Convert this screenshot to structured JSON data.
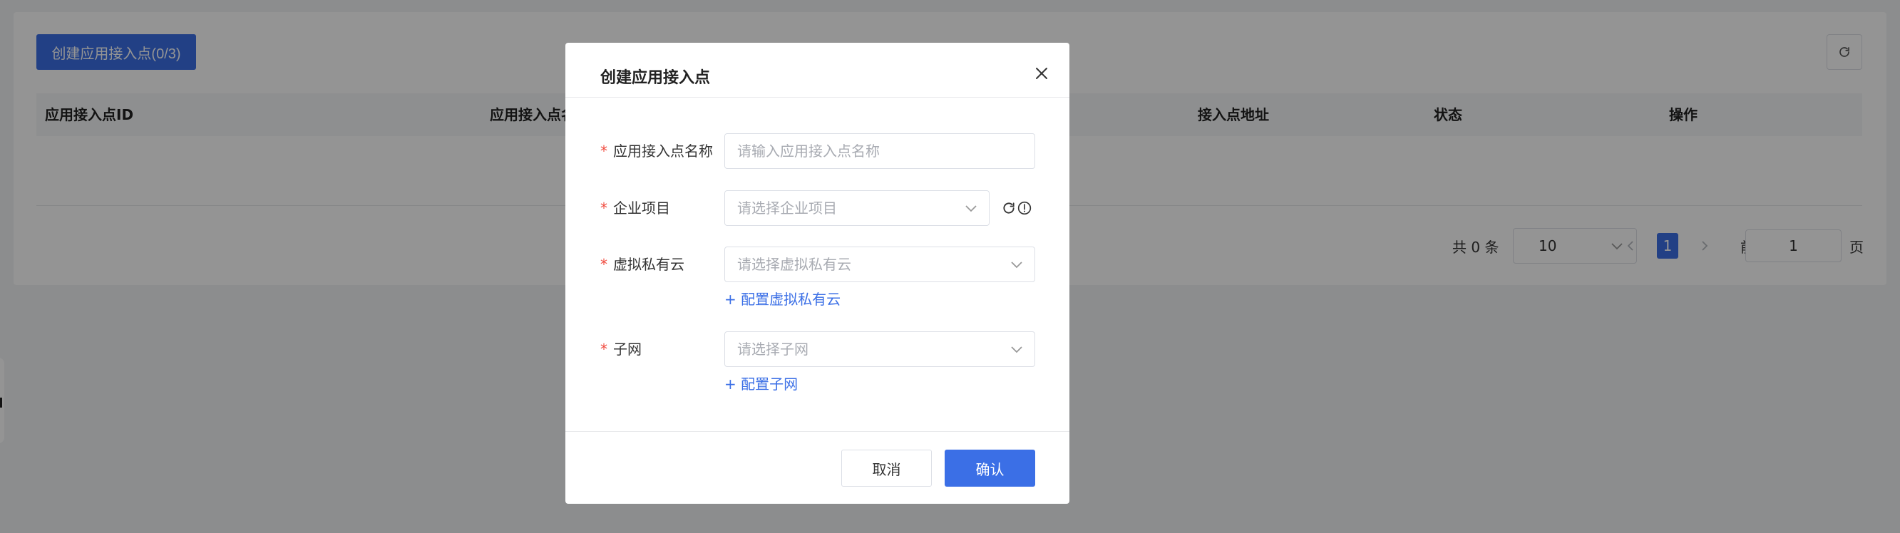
{
  "toolbar": {
    "create_button_label": "创建应用接入点(0/3)"
  },
  "table": {
    "columns": [
      "应用接入点ID",
      "应用接入点名",
      "接入点地址",
      "状态",
      "操作"
    ]
  },
  "pagination": {
    "total_text": "共 0 条",
    "page_size": "10",
    "current_page": "1",
    "goto_prefix": "前往",
    "goto_value": "1",
    "goto_suffix": "页"
  },
  "dialog": {
    "title": "创建应用接入点",
    "required_mark": "*",
    "fields": {
      "name": {
        "label": "应用接入点名称",
        "placeholder": "请输入应用接入点名称"
      },
      "project": {
        "label": "企业项目",
        "placeholder": "请选择企业项目"
      },
      "vpc": {
        "label": "虚拟私有云",
        "placeholder": "请选择虚拟私有云",
        "link": "+ 配置虚拟私有云"
      },
      "subnet": {
        "label": "子网",
        "placeholder": "请选择子网",
        "link": "+ 配置子网"
      }
    },
    "cancel_label": "取消",
    "confirm_label": "确认"
  },
  "icons": {
    "close": "close-icon",
    "refresh": "refresh-icon",
    "info": "info-icon",
    "chevron": "chevron-down-icon"
  },
  "colors": {
    "primary": "#3b6fe6",
    "required": "#f04a3e",
    "overlay": "rgba(0,0,0,0.42)"
  }
}
